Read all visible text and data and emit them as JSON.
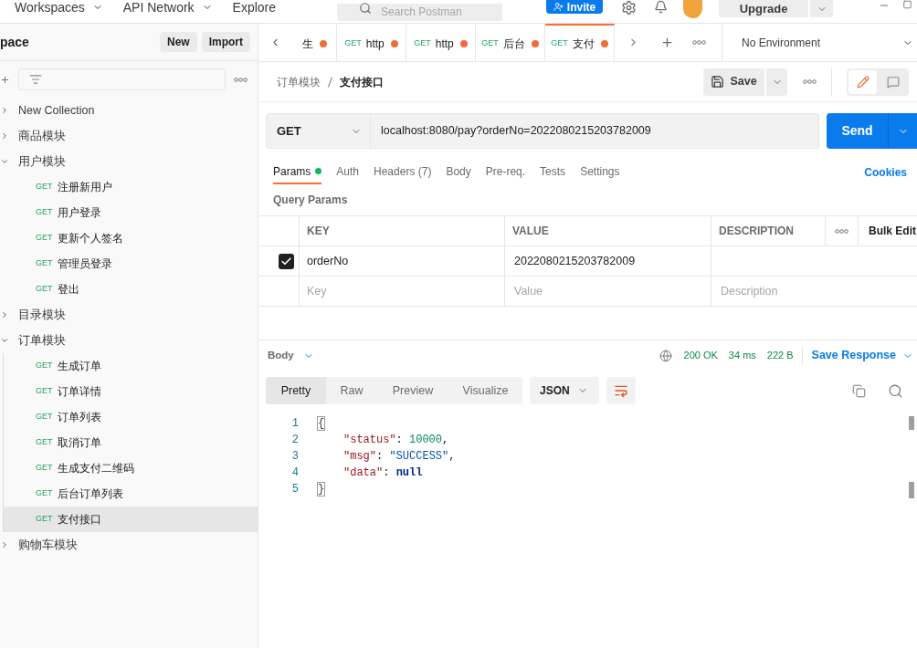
{
  "top_bar": {
    "nav": [
      {
        "label": "Workspaces",
        "dropdown": true
      },
      {
        "label": "API Network",
        "dropdown": true
      },
      {
        "label": "Explore",
        "dropdown": false
      }
    ],
    "search": {
      "placeholder": "Search Postman"
    },
    "invite": "Invite",
    "upgrade": "Upgrade"
  },
  "sidebar": {
    "workspace": "pace",
    "buttons": [
      "New",
      "Import"
    ],
    "tree": [
      {
        "name": "New Collection",
        "expanded": false
      },
      {
        "name": "商品模块",
        "expanded": false
      },
      {
        "name": "用户模块",
        "expanded": true,
        "children": [
          {
            "method": "GET",
            "name": "注册新用户",
            "selected": false
          },
          {
            "method": "GET",
            "name": "用户登录",
            "selected": false
          },
          {
            "method": "GET",
            "name": "更新个人签名",
            "selected": false
          },
          {
            "method": "GET",
            "name": "管理员登录",
            "selected": false
          },
          {
            "method": "GET",
            "name": "登出",
            "selected": false
          }
        ]
      },
      {
        "name": "目录模块",
        "expanded": false
      },
      {
        "name": "订单模块",
        "expanded": true,
        "children": [
          {
            "method": "GET",
            "name": "生成订单",
            "selected": false
          },
          {
            "method": "GET",
            "name": "订单详情",
            "selected": false
          },
          {
            "method": "GET",
            "name": "订单列表",
            "selected": false
          },
          {
            "method": "GET",
            "name": "取消订单",
            "selected": false
          },
          {
            "method": "GET",
            "name": "生成支付二维码",
            "selected": false
          },
          {
            "method": "GET",
            "name": "后台订单列表",
            "selected": false
          },
          {
            "method": "GET",
            "name": "支付接口",
            "selected": true
          }
        ]
      },
      {
        "name": "购物车模块",
        "expanded": false
      }
    ]
  },
  "tabs": [
    {
      "label": "生",
      "unsaved": true,
      "selected": false
    },
    {
      "method": "GET",
      "label": "http",
      "unsaved": true,
      "selected": false
    },
    {
      "method": "GET",
      "label": "http",
      "unsaved": true,
      "selected": false
    },
    {
      "method": "GET",
      "label": "后台",
      "unsaved": true,
      "selected": false
    },
    {
      "method": "GET",
      "label": "支付",
      "unsaved": true,
      "selected": true
    }
  ],
  "environment": {
    "label": "No Environment"
  },
  "breadcrumb": {
    "parent": "订单模块",
    "current": "支付接口"
  },
  "save": "Save",
  "view_modes": [
    {
      "kind": "edit",
      "selected": true
    },
    {
      "kind": "comments",
      "selected": false
    }
  ],
  "request": {
    "method": "GET",
    "url": "localhost:8080/pay?orderNo=2022080215203782009",
    "send": "Send"
  },
  "request_tabs": [
    {
      "label": "Params",
      "selected": true,
      "dot": true
    },
    {
      "label": "Auth",
      "selected": false,
      "dot": false
    },
    {
      "label": "Headers (7)",
      "selected": false,
      "dot": false
    },
    {
      "label": "Body",
      "selected": false,
      "dot": false
    },
    {
      "label": "Pre-req.",
      "selected": false,
      "dot": false
    },
    {
      "label": "Tests",
      "selected": false,
      "dot": false
    },
    {
      "label": "Settings",
      "selected": false,
      "dot": false
    }
  ],
  "cookies": "Cookies",
  "query_params": {
    "title": "Query Params",
    "columns": [
      "KEY",
      "VALUE",
      "DESCRIPTION"
    ],
    "bulk_edit": "Bulk Edit",
    "rows": [
      {
        "checked": true,
        "key": "orderNo",
        "value": "2022080215203782009"
      }
    ],
    "new_row": {
      "key": {
        "placeholder": "Key"
      },
      "value": {
        "placeholder": "Value"
      },
      "description": {
        "placeholder": "Description"
      }
    }
  },
  "response": {
    "section": "Body",
    "status": "200 OK",
    "time": "34 ms",
    "size": "222 B",
    "save": "Save Response",
    "views": [
      {
        "label": "Pretty",
        "selected": true
      },
      {
        "label": "Raw",
        "selected": false
      },
      {
        "label": "Preview",
        "selected": false
      },
      {
        "label": "Visualize",
        "selected": false
      }
    ],
    "format": "JSON",
    "lines": [
      {
        "number": "1",
        "tokens": [
          {
            "kind": "brace",
            "text": "{"
          }
        ],
        "children": [
          {
            "number": "2",
            "tokens": [
              {
                "kind": "key",
                "text": "\"status\""
              },
              {
                "kind": "punct",
                "text": ": "
              },
              {
                "kind": "number",
                "text": "10000"
              },
              {
                "kind": "punct",
                "text": ","
              }
            ]
          },
          {
            "number": "3",
            "tokens": [
              {
                "kind": "key",
                "text": "\"msg\""
              },
              {
                "kind": "punct",
                "text": ": "
              },
              {
                "kind": "string",
                "text": "\"SUCCESS\""
              },
              {
                "kind": "punct",
                "text": ","
              }
            ]
          },
          {
            "number": "4",
            "tokens": [
              {
                "kind": "key",
                "text": "\"data\""
              },
              {
                "kind": "punct",
                "text": ": "
              },
              {
                "kind": "literal",
                "text": "null"
              }
            ]
          }
        ]
      },
      {
        "number": "5",
        "tokens": [
          {
            "kind": "brace",
            "text": "}"
          }
        ]
      }
    ]
  }
}
